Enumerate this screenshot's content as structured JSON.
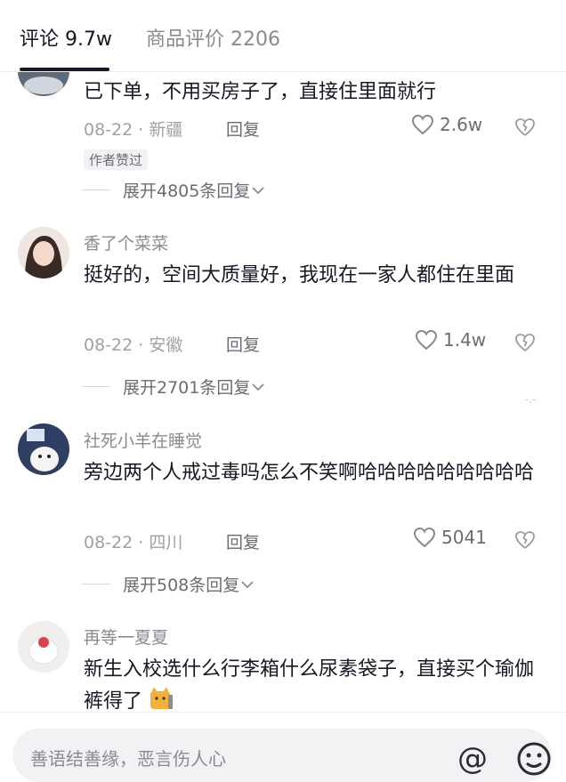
{
  "tabs": {
    "comments": "评论 9.7w",
    "product_reviews": "商品评价 2206"
  },
  "comments": [
    {
      "username": "",
      "text": "已下单，不用买房子了，直接住里面就行",
      "date": "08-22",
      "location": "新疆",
      "reply_label": "回复",
      "likes": "2.6w",
      "author_liked": "作者赞过",
      "expand_label": "展开4805条回复"
    },
    {
      "username": "香了个菜菜",
      "text": "挺好的，空间大质量好，我现在一家人都住在里面",
      "date": "08-22",
      "location": "安徽",
      "reply_label": "回复",
      "likes": "1.4w",
      "expand_label": "展开2701条回复"
    },
    {
      "username": "社死小羊在睡觉",
      "text": "旁边两个人戒过毒吗怎么不笑啊哈哈哈哈哈哈哈哈哈",
      "date": "08-22",
      "location": "四川",
      "reply_label": "回复",
      "likes": "5041",
      "expand_label": "展开508条回复"
    },
    {
      "username": "再等一夏夏",
      "text": "新生入校选什么行李箱什么尿素袋子，直接买个瑜伽裤得了"
    }
  ],
  "input": {
    "placeholder": "善语结善缘，恶言伤人心"
  },
  "icons": {
    "like": "heart-outline-icon",
    "dislike": "broken-heart-icon",
    "expand": "chevron-down-icon",
    "mention": "at-icon",
    "emoji": "emoji-icon"
  },
  "colors": {
    "text_primary": "#161823",
    "text_secondary": "#8a8b91"
  }
}
